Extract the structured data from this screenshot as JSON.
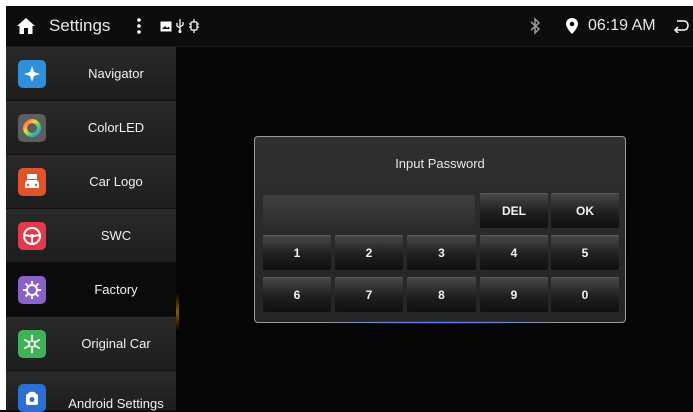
{
  "statusbar": {
    "title": "Settings",
    "time": "06:19 AM"
  },
  "sidebar": {
    "items": [
      {
        "label": "Navigator",
        "icon": "compass-icon",
        "color": "#2f8fd8"
      },
      {
        "label": "ColorLED",
        "icon": "color-ring-icon",
        "color": "#6a6a6a"
      },
      {
        "label": "Car Logo",
        "icon": "car-logo-icon",
        "color": "#e0542b"
      },
      {
        "label": "SWC",
        "icon": "steering-wheel-icon",
        "color": "#e23a4c"
      },
      {
        "label": "Factory",
        "icon": "factory-gear-icon",
        "color": "#8a62c9"
      },
      {
        "label": "Original Car",
        "icon": "snowflake-gear-icon",
        "color": "#3fb457"
      },
      {
        "label": "Android Settings",
        "icon": "android-gear-icon",
        "color": "#2a6fd1"
      }
    ],
    "active_index": 4
  },
  "dialog": {
    "title": "Input Password",
    "password_value": "",
    "del_label": "DEL",
    "ok_label": "OK",
    "keys_row1": [
      "1",
      "2",
      "3",
      "4",
      "5"
    ],
    "keys_row2": [
      "6",
      "7",
      "8",
      "9",
      "0"
    ]
  },
  "colors": {
    "background": "#060606",
    "accent_glow": "#4d6cff"
  }
}
